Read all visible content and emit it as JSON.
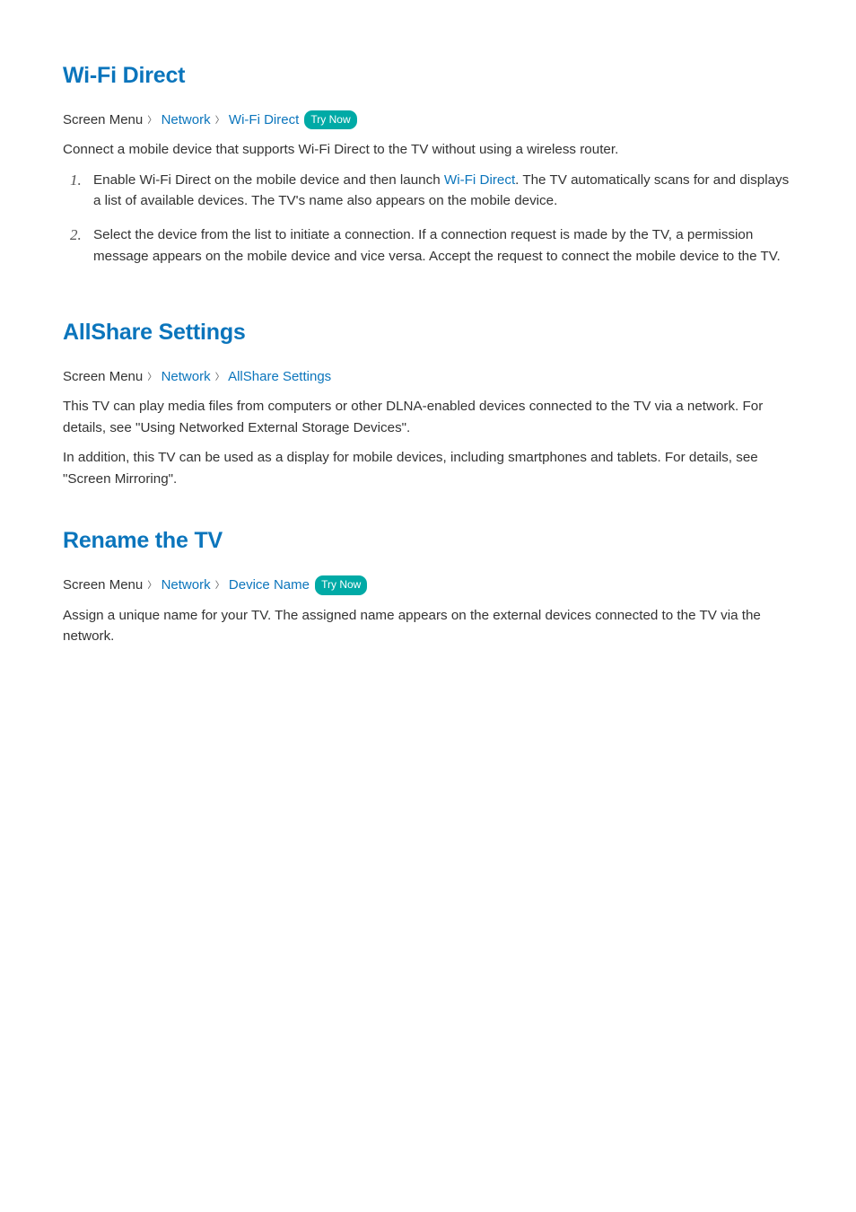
{
  "section1": {
    "heading": "Wi-Fi Direct",
    "crumb": {
      "prefix": "Screen Menu",
      "part1": "Network",
      "part2": "Wi-Fi Direct",
      "try": "Try Now"
    },
    "intro": "Connect a mobile device that supports Wi-Fi Direct to the TV without using a wireless router.",
    "steps": [
      {
        "num": "1.",
        "pre": "Enable Wi-Fi Direct on the mobile device and then launch ",
        "link": "Wi-Fi Direct",
        "post": ". The TV automatically scans for and displays a list of available devices. The TV's name also appears on the mobile device."
      },
      {
        "num": "2.",
        "text": "Select the device from the list to initiate a connection. If a connection request is made by the TV, a permission message appears on the mobile device and vice versa. Accept the request to connect the mobile device to the TV."
      }
    ]
  },
  "section2": {
    "heading": "AllShare Settings",
    "crumb": {
      "prefix": "Screen Menu",
      "part1": "Network",
      "part2": "AllShare Settings"
    },
    "para1": "This TV can play media files from computers or other DLNA-enabled devices connected to the TV via a network. For details, see \"Using Networked External Storage Devices\".",
    "para2": "In addition, this TV can be used as a display for mobile devices, including smartphones and tablets. For details, see \"Screen Mirroring\"."
  },
  "section3": {
    "heading": "Rename the TV",
    "crumb": {
      "prefix": "Screen Menu",
      "part1": "Network",
      "part2": "Device Name",
      "try": "Try Now"
    },
    "para": "Assign a unique name for your TV. The assigned name appears on the external devices connected to the TV via the network."
  },
  "sep": "〉"
}
